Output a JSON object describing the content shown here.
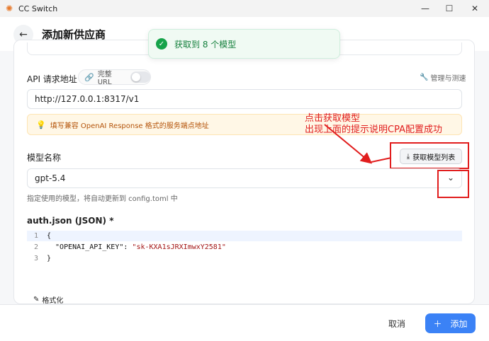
{
  "window": {
    "title": "CC Switch"
  },
  "header": {
    "title": "添加新供应商"
  },
  "toast": {
    "message": "获取到 8 个模型"
  },
  "api": {
    "label": "API 请求地址",
    "full_url_label": "完整 URL",
    "manage_label": "管理与测速",
    "url_value": "http://127.0.0.1:8317/v1",
    "hint": "填写兼容 OpenAI Response 格式的服务端点地址"
  },
  "annotation": {
    "line1": "点击获取模型",
    "line2": "出现上面的提示说明CPA配置成功"
  },
  "model": {
    "label": "模型名称",
    "fetch_button": "获取模型列表",
    "value": "gpt-5.4",
    "help": "指定使用的模型，将自动更新到 config.toml 中"
  },
  "auth": {
    "label": "auth.json (JSON) *",
    "lines": [
      {
        "num": "1",
        "text": "{"
      },
      {
        "num": "2",
        "key": "  \"OPENAI_API_KEY\": ",
        "value": "\"sk-KXA1sJRXImwxY2581\""
      },
      {
        "num": "3",
        "text": "}"
      }
    ],
    "format_label": "格式化"
  },
  "footer": {
    "cancel": "取消",
    "add": "添加"
  },
  "colors": {
    "accent": "#3b82f6",
    "success": "#16a34a",
    "annotation": "#e11d1d"
  }
}
